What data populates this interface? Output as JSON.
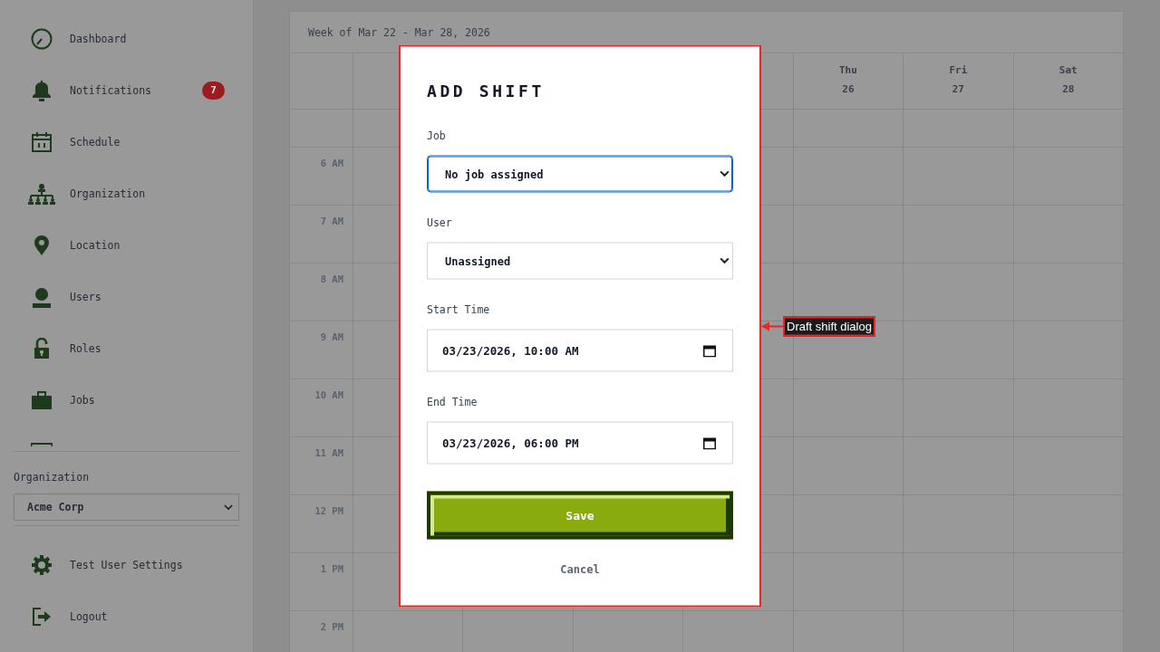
{
  "sidebar": {
    "nav_items": [
      {
        "label": "Dashboard"
      },
      {
        "label": "Notifications",
        "badge": "7"
      },
      {
        "label": "Schedule"
      },
      {
        "label": "Organization"
      },
      {
        "label": "Location"
      },
      {
        "label": "Users"
      },
      {
        "label": "Roles"
      },
      {
        "label": "Jobs"
      }
    ],
    "organization": {
      "label": "Organization",
      "value": "Acme Corp"
    },
    "footer_items": [
      {
        "label": "Test User Settings"
      },
      {
        "label": "Logout"
      }
    ]
  },
  "calendar": {
    "title": "Week of Mar 22 - Mar 28, 2026",
    "days": [
      {
        "name": "Thu",
        "date": "26"
      },
      {
        "name": "Fri",
        "date": "27"
      },
      {
        "name": "Sat",
        "date": "28"
      }
    ],
    "hours": [
      "6 AM",
      "7 AM",
      "8 AM",
      "9 AM",
      "10 AM",
      "11 AM",
      "12 PM",
      "1 PM",
      "2 PM"
    ]
  },
  "dialog": {
    "title": "ADD SHIFT",
    "fields": [
      {
        "label": "Job",
        "kind": "select",
        "value": "No job assigned",
        "focused": true
      },
      {
        "label": "User",
        "kind": "select",
        "value": "Unassigned",
        "focused": false
      },
      {
        "label": "Start Time",
        "kind": "datetime",
        "value": "03/23/2026, 10:00 AM",
        "focused": false
      },
      {
        "label": "End Time",
        "kind": "datetime",
        "value": "03/23/2026, 06:00 PM",
        "focused": false
      }
    ],
    "buttons": [
      {
        "label": "Save",
        "kind": "primary"
      },
      {
        "label": "Cancel",
        "kind": "link"
      }
    ]
  },
  "annotation": {
    "label": "Draft shift dialog"
  }
}
